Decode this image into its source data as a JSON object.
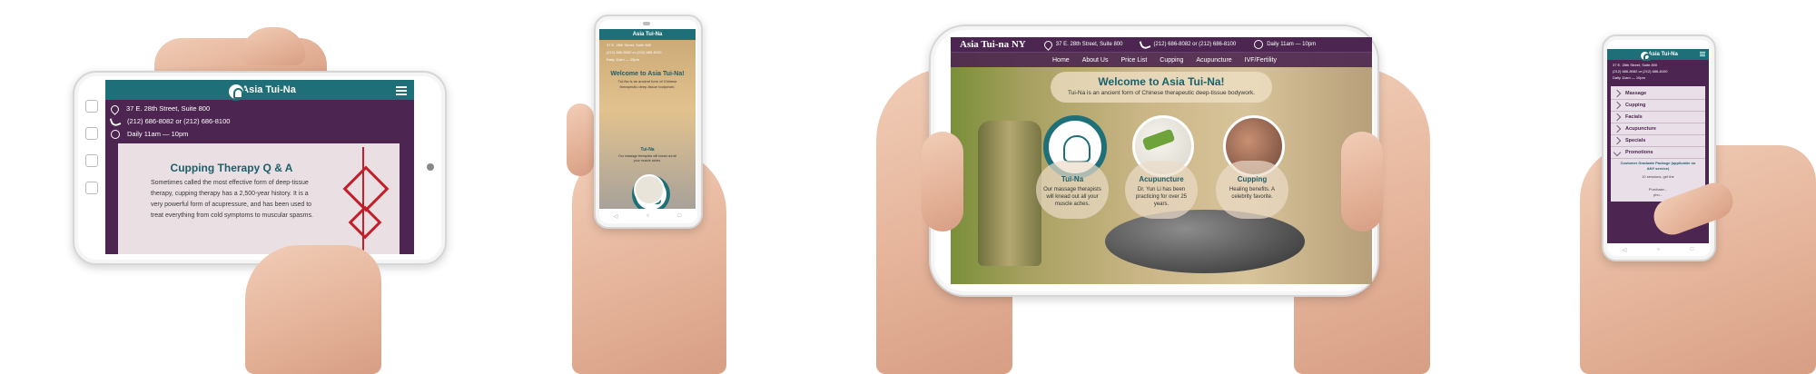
{
  "brand": {
    "short": "Asia Tui-Na",
    "full": "Asia Tui-na NY"
  },
  "contact": {
    "address": "37 E. 28th Street, Suite 800",
    "phone": "(212) 686-8082 or (212) 686-8100",
    "hours": "Daily 11am — 10pm"
  },
  "nav": [
    "Home",
    "About Us",
    "Price List",
    "Cupping",
    "Acupuncture",
    "IVF/Fertility"
  ],
  "cupping_page": {
    "title": "Cupping Therapy Q & A",
    "body": "Sometimes called the most effective form of deep-tissue therapy, cupping therapy has a 2,500-year history. It is a very powerful form of acupressure, and has been used to treat everything from cold symptoms to muscular spasms."
  },
  "welcome": {
    "title": "Welcome to Asia Tui-Na!",
    "subtitle": "Tui-Na is an ancient form of Chinese therapeutic deep-tissue bodywork."
  },
  "features": [
    {
      "title": "Tui-Na",
      "text": "Our massage therapists will knead out all your muscle aches."
    },
    {
      "title": "Acupuncture",
      "text": "Dr. Yun Li has been practicing for over 25 years."
    },
    {
      "title": "Cupping",
      "text": "Healing benefits. A celebrity favorite."
    }
  ],
  "phone2": {
    "tile_text": "Our massage therapists will knead out all your muscle aches."
  },
  "mobile_menu": {
    "items": [
      "Massage",
      "Cupping",
      "Facials",
      "Acupuncture",
      "Specials",
      "Promotions"
    ],
    "sub_items": [
      "Customer Graduate Package (applicable on ANY service)",
      "10 sessions, get the",
      "Purchase...",
      "pho..."
    ]
  },
  "colors": {
    "teal": "#1f6f78",
    "purple": "#4c2650",
    "accent_red": "#c41e2a",
    "heading_teal": "#1c5f6a"
  }
}
